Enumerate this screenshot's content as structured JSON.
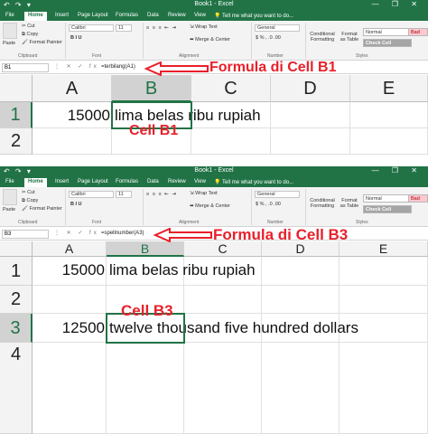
{
  "window": {
    "title": "Book1 - Excel",
    "qat": "↶ ↷ ▾",
    "controls": "— ❐ ✕"
  },
  "tabs": [
    "File",
    "Home",
    "Insert",
    "Page Layout",
    "Formulas",
    "Data",
    "Review",
    "View"
  ],
  "tell_me": "Tell me what you want to do...",
  "ribbon": {
    "clipboard": {
      "paste": "Paste",
      "cut": "Cut",
      "copy": "Copy",
      "format_painter": "Format Painter",
      "label": "Clipboard"
    },
    "font": {
      "name": "Calibri",
      "size": "11",
      "label": "Font",
      "styles": "B  I  U"
    },
    "alignment": {
      "wrap": "Wrap Text",
      "merge": "Merge & Center",
      "label": "Alignment"
    },
    "number": {
      "format": "General",
      "label": "Number",
      "tools": "$ % ,  .0 .00"
    },
    "styles": {
      "conditional": "Conditional Formatting",
      "format_as_table": "Format as Table",
      "normal": "Normal",
      "bad": "Bad",
      "check_cell": "Check Cell",
      "label": "Styles"
    }
  },
  "columns": [
    "A",
    "B",
    "C",
    "D",
    "E"
  ],
  "top": {
    "namebox": "B1",
    "formula": "=terbilang(A1)",
    "rows": [
      "1",
      "2"
    ],
    "row1_a": "15000",
    "row1_b": "lima belas ribu rupiah",
    "annot_formula": "Formula di Cell B1",
    "annot_cell": "Cell B1"
  },
  "bottom": {
    "namebox": "B3",
    "formula": "=spellnumber(A3)",
    "rows": [
      "1",
      "2",
      "3",
      "4"
    ],
    "row1_a": "15000",
    "row1_b": "lima belas ribu rupiah",
    "row3_a": "12500",
    "row3_b": "twelve thousand five  hundred dollars",
    "annot_formula": "Formula di Cell B3",
    "annot_cell": "Cell B3"
  },
  "colors": {
    "excel_green": "#217346",
    "annotation_red": "#e8202a",
    "bad_fill": "#ffc7ce",
    "normal_fill": "#ffffff"
  }
}
